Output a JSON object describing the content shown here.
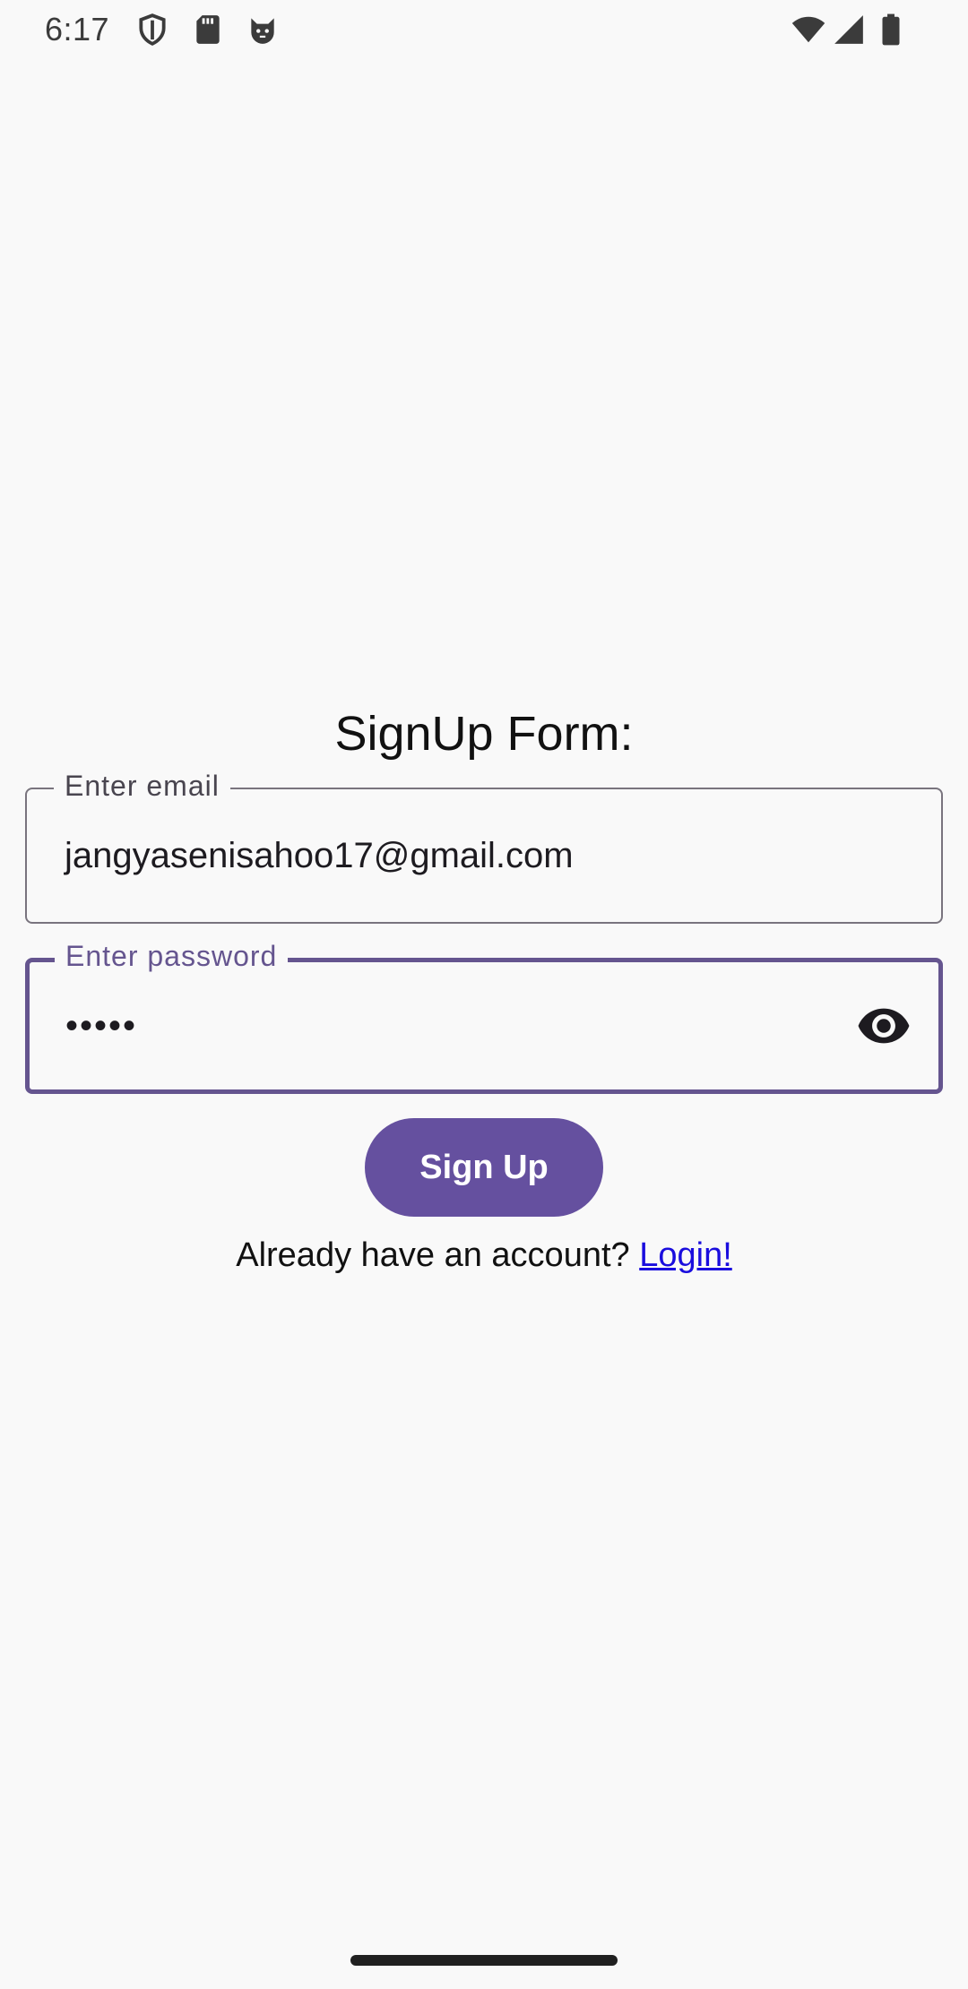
{
  "status_bar": {
    "time": "6:17",
    "icons_left": [
      "shield-icon",
      "sd-card-icon",
      "cat-face-icon"
    ],
    "icons_right": [
      "wifi-icon",
      "signal-icon",
      "battery-icon"
    ]
  },
  "form": {
    "title": "SignUp Form:",
    "email": {
      "label": "Enter email",
      "value": "jangyasenisahoo17@gmail.com"
    },
    "password": {
      "label": "Enter password",
      "value": "•••••",
      "visibility_icon": "eye-icon"
    },
    "signup_label": "Sign Up",
    "login_prompt": "Already have an account?",
    "login_link": "Login!"
  },
  "colors": {
    "primary": "#65509f",
    "focused_outline": "#65558f",
    "outline": "#79747e",
    "link": "#1a0dde",
    "background": "#f9f9f9"
  }
}
